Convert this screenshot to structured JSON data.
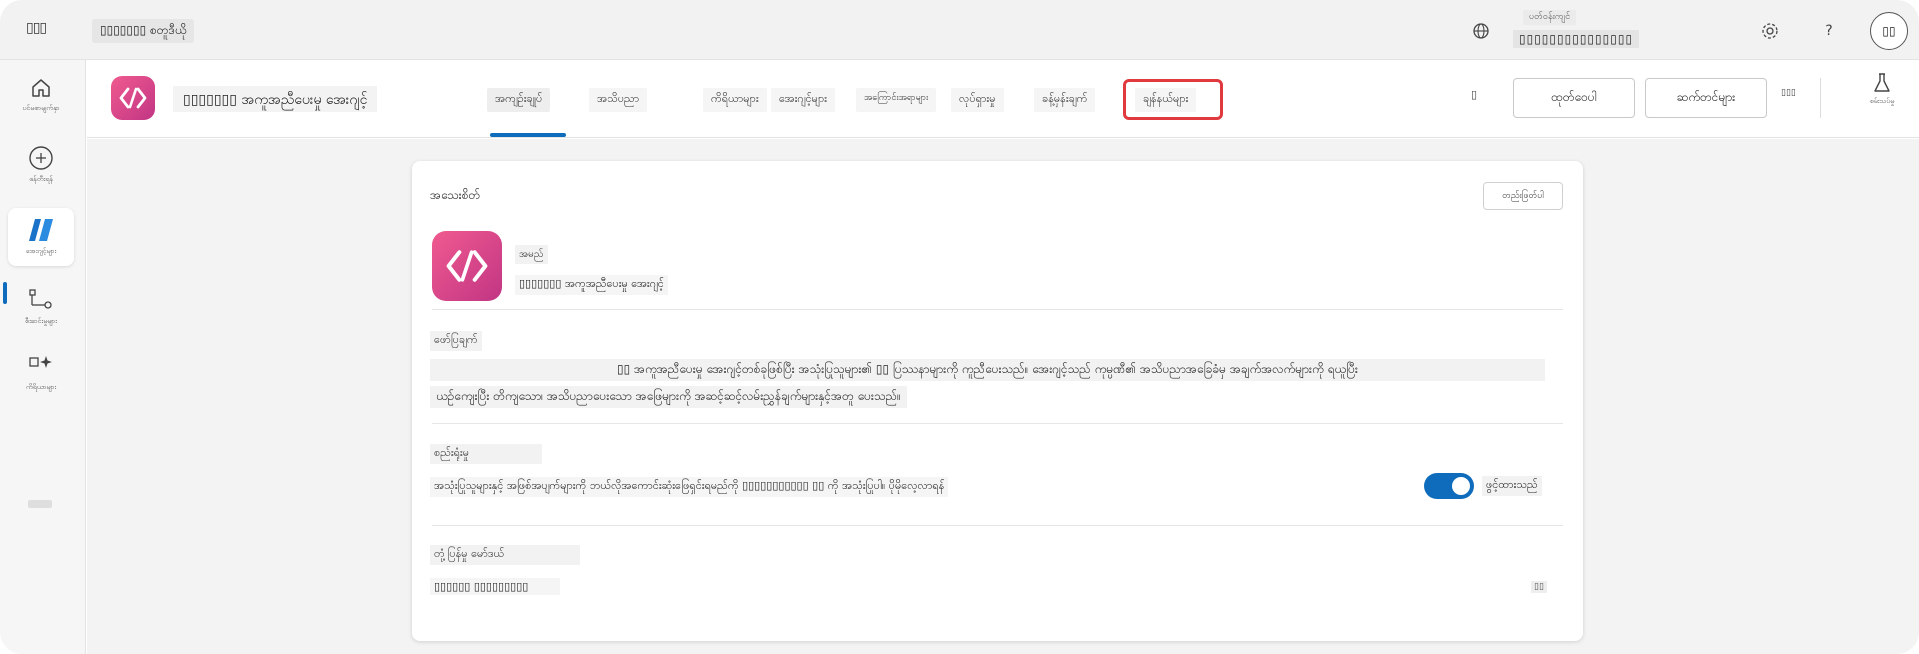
{
  "topbar": {
    "waffle_label": "▯▯▯",
    "environment_name": "▯▯▯▯▯▯▯ စတူဒီယို",
    "env_label": "ပတ်ဝန်းကျင်",
    "env_value": "▯▯▯▯▯▯▯▯▯▯▯▯▯▯▯",
    "help_label": "?",
    "avatar_initials": "▯▯"
  },
  "rail": {
    "items": [
      {
        "label": "ပင်မစာမျက်နှာ"
      },
      {
        "label": "ဖန်တီးရန်"
      },
      {
        "label": "အေးဂျင့်များ"
      },
      {
        "label": "စီးဆင်းမှုများ"
      },
      {
        "label": "ကိရိယာများ"
      }
    ]
  },
  "appbar": {
    "title": "▯▯▯▯▯▯▯ အကူအညီပေးမှု အေးဂျင့်",
    "tabs": [
      {
        "label": "အကျဉ်းချုပ်"
      },
      {
        "label": "အသိပညာ"
      },
      {
        "label": "ကိရိယာများ"
      },
      {
        "label": "အေးဂျင့်များ"
      },
      {
        "label": "အကြောင်းအရာများ"
      },
      {
        "label": "လုပ်ရှားမှု"
      },
      {
        "label": "ခန့်မှန်းချက်"
      },
      {
        "label": "ချန်နယ်များ"
      }
    ],
    "icon_label": "▯",
    "publish_label": "ထုတ်ဝေပါ",
    "settings_label": "ဆက်တင်များ",
    "more_label": "▯▯▯",
    "labs_label": "စမ်းသပ်မှု"
  },
  "details": {
    "section_title": "အသေးစိတ်",
    "edit_label": "တည်းဖြတ်ပါ",
    "name_label": "အမည်",
    "name_value": "▯▯▯▯▯▯▯ အကူအညီပေးမှု အေးဂျင့်",
    "description_label": "ဖော်ပြချက်",
    "description_line1": "▯▯ အကူအညီပေးမှု အေးဂျင့်တစ်ခုဖြစ်ပြီး အသုံးပြုသူများ၏ ▯▯ ပြဿနာများကို ကူညီပေးသည်။ အေးဂျင့်သည် ကုမ္ပဏီ၏ အသိပညာအခြေခံမှ အချက်အလက်များကို ရယူပြီး",
    "description_line2": "ယဉ်ကျေးပြီး တိကျသော၊ အသိပညာပေးသော အဖြေများကို အဆင့်ဆင့်လမ်းညွှန်ချက်များနှင့်အတူ ပေးသည်။",
    "orchestration_label": "စည်းရုံးမှု",
    "orchestration_text": "အသုံးပြုသူများနှင့် အဖြစ်အပျက်များကို ဘယ်လိုအကောင်းဆုံးဖြေရှင်းရမည်ကို ▯▯▯▯▯▯▯▯▯▯▯ ▯▯ ကို အသုံးပြုပါ။ ပိုမိုလေ့လာရန်",
    "toggle_label": "ဖွင့်ထားသည်",
    "response_model_label": "တုံ့ပြန်မှု မော်ဒယ်",
    "response_model_value": "▯▯▯▯▯▯ ▯▯▯▯▯▯▯▯▯",
    "copy_label": "▯▯"
  }
}
